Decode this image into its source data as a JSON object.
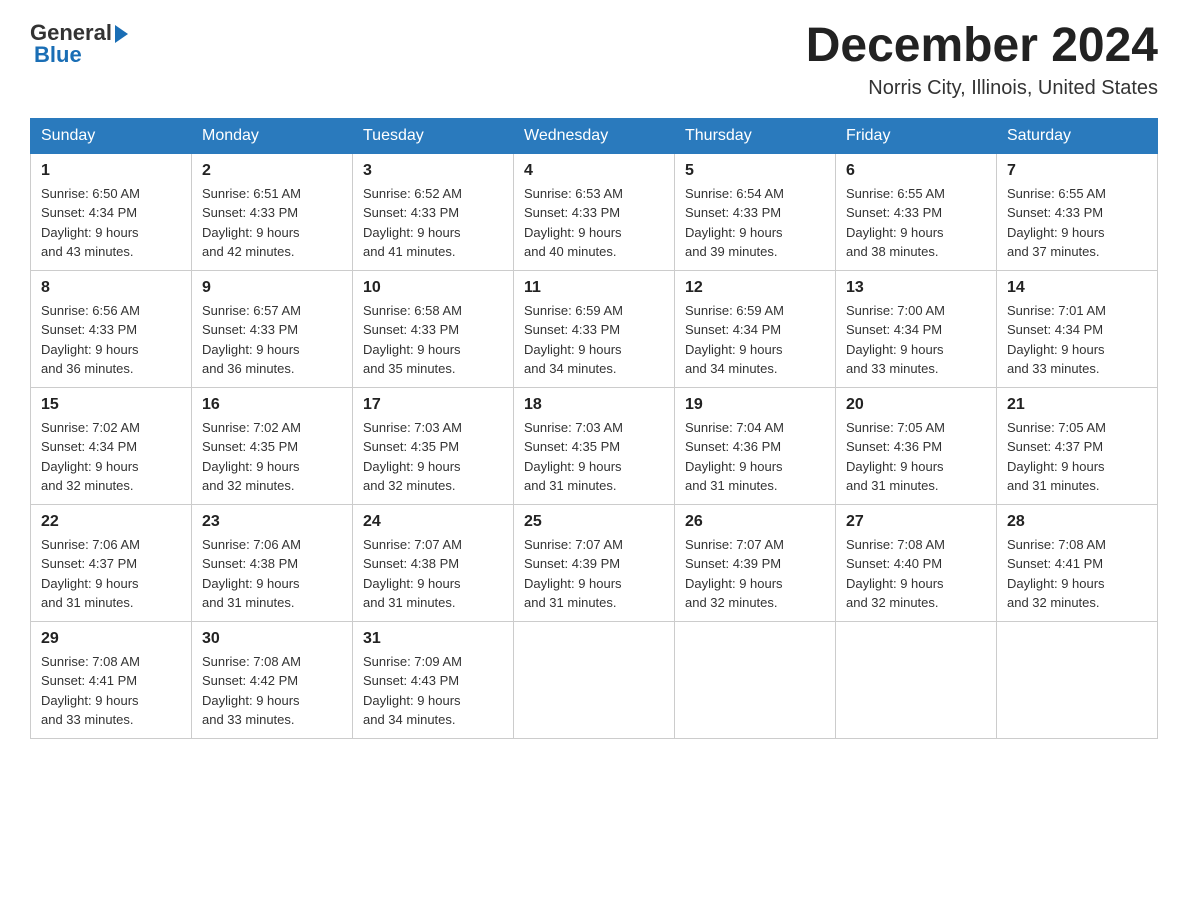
{
  "header": {
    "logo_general": "General",
    "logo_arrow": "▶",
    "logo_blue": "Blue",
    "month_title": "December 2024",
    "location": "Norris City, Illinois, United States"
  },
  "weekdays": [
    "Sunday",
    "Monday",
    "Tuesday",
    "Wednesday",
    "Thursday",
    "Friday",
    "Saturday"
  ],
  "weeks": [
    [
      {
        "day": "1",
        "sunrise": "6:50 AM",
        "sunset": "4:34 PM",
        "daylight": "9 hours and 43 minutes."
      },
      {
        "day": "2",
        "sunrise": "6:51 AM",
        "sunset": "4:33 PM",
        "daylight": "9 hours and 42 minutes."
      },
      {
        "day": "3",
        "sunrise": "6:52 AM",
        "sunset": "4:33 PM",
        "daylight": "9 hours and 41 minutes."
      },
      {
        "day": "4",
        "sunrise": "6:53 AM",
        "sunset": "4:33 PM",
        "daylight": "9 hours and 40 minutes."
      },
      {
        "day": "5",
        "sunrise": "6:54 AM",
        "sunset": "4:33 PM",
        "daylight": "9 hours and 39 minutes."
      },
      {
        "day": "6",
        "sunrise": "6:55 AM",
        "sunset": "4:33 PM",
        "daylight": "9 hours and 38 minutes."
      },
      {
        "day": "7",
        "sunrise": "6:55 AM",
        "sunset": "4:33 PM",
        "daylight": "9 hours and 37 minutes."
      }
    ],
    [
      {
        "day": "8",
        "sunrise": "6:56 AM",
        "sunset": "4:33 PM",
        "daylight": "9 hours and 36 minutes."
      },
      {
        "day": "9",
        "sunrise": "6:57 AM",
        "sunset": "4:33 PM",
        "daylight": "9 hours and 36 minutes."
      },
      {
        "day": "10",
        "sunrise": "6:58 AM",
        "sunset": "4:33 PM",
        "daylight": "9 hours and 35 minutes."
      },
      {
        "day": "11",
        "sunrise": "6:59 AM",
        "sunset": "4:33 PM",
        "daylight": "9 hours and 34 minutes."
      },
      {
        "day": "12",
        "sunrise": "6:59 AM",
        "sunset": "4:34 PM",
        "daylight": "9 hours and 34 minutes."
      },
      {
        "day": "13",
        "sunrise": "7:00 AM",
        "sunset": "4:34 PM",
        "daylight": "9 hours and 33 minutes."
      },
      {
        "day": "14",
        "sunrise": "7:01 AM",
        "sunset": "4:34 PM",
        "daylight": "9 hours and 33 minutes."
      }
    ],
    [
      {
        "day": "15",
        "sunrise": "7:02 AM",
        "sunset": "4:34 PM",
        "daylight": "9 hours and 32 minutes."
      },
      {
        "day": "16",
        "sunrise": "7:02 AM",
        "sunset": "4:35 PM",
        "daylight": "9 hours and 32 minutes."
      },
      {
        "day": "17",
        "sunrise": "7:03 AM",
        "sunset": "4:35 PM",
        "daylight": "9 hours and 32 minutes."
      },
      {
        "day": "18",
        "sunrise": "7:03 AM",
        "sunset": "4:35 PM",
        "daylight": "9 hours and 31 minutes."
      },
      {
        "day": "19",
        "sunrise": "7:04 AM",
        "sunset": "4:36 PM",
        "daylight": "9 hours and 31 minutes."
      },
      {
        "day": "20",
        "sunrise": "7:05 AM",
        "sunset": "4:36 PM",
        "daylight": "9 hours and 31 minutes."
      },
      {
        "day": "21",
        "sunrise": "7:05 AM",
        "sunset": "4:37 PM",
        "daylight": "9 hours and 31 minutes."
      }
    ],
    [
      {
        "day": "22",
        "sunrise": "7:06 AM",
        "sunset": "4:37 PM",
        "daylight": "9 hours and 31 minutes."
      },
      {
        "day": "23",
        "sunrise": "7:06 AM",
        "sunset": "4:38 PM",
        "daylight": "9 hours and 31 minutes."
      },
      {
        "day": "24",
        "sunrise": "7:07 AM",
        "sunset": "4:38 PM",
        "daylight": "9 hours and 31 minutes."
      },
      {
        "day": "25",
        "sunrise": "7:07 AM",
        "sunset": "4:39 PM",
        "daylight": "9 hours and 31 minutes."
      },
      {
        "day": "26",
        "sunrise": "7:07 AM",
        "sunset": "4:39 PM",
        "daylight": "9 hours and 32 minutes."
      },
      {
        "day": "27",
        "sunrise": "7:08 AM",
        "sunset": "4:40 PM",
        "daylight": "9 hours and 32 minutes."
      },
      {
        "day": "28",
        "sunrise": "7:08 AM",
        "sunset": "4:41 PM",
        "daylight": "9 hours and 32 minutes."
      }
    ],
    [
      {
        "day": "29",
        "sunrise": "7:08 AM",
        "sunset": "4:41 PM",
        "daylight": "9 hours and 33 minutes."
      },
      {
        "day": "30",
        "sunrise": "7:08 AM",
        "sunset": "4:42 PM",
        "daylight": "9 hours and 33 minutes."
      },
      {
        "day": "31",
        "sunrise": "7:09 AM",
        "sunset": "4:43 PM",
        "daylight": "9 hours and 34 minutes."
      },
      null,
      null,
      null,
      null
    ]
  ],
  "labels": {
    "sunrise": "Sunrise:",
    "sunset": "Sunset:",
    "daylight": "Daylight:"
  }
}
